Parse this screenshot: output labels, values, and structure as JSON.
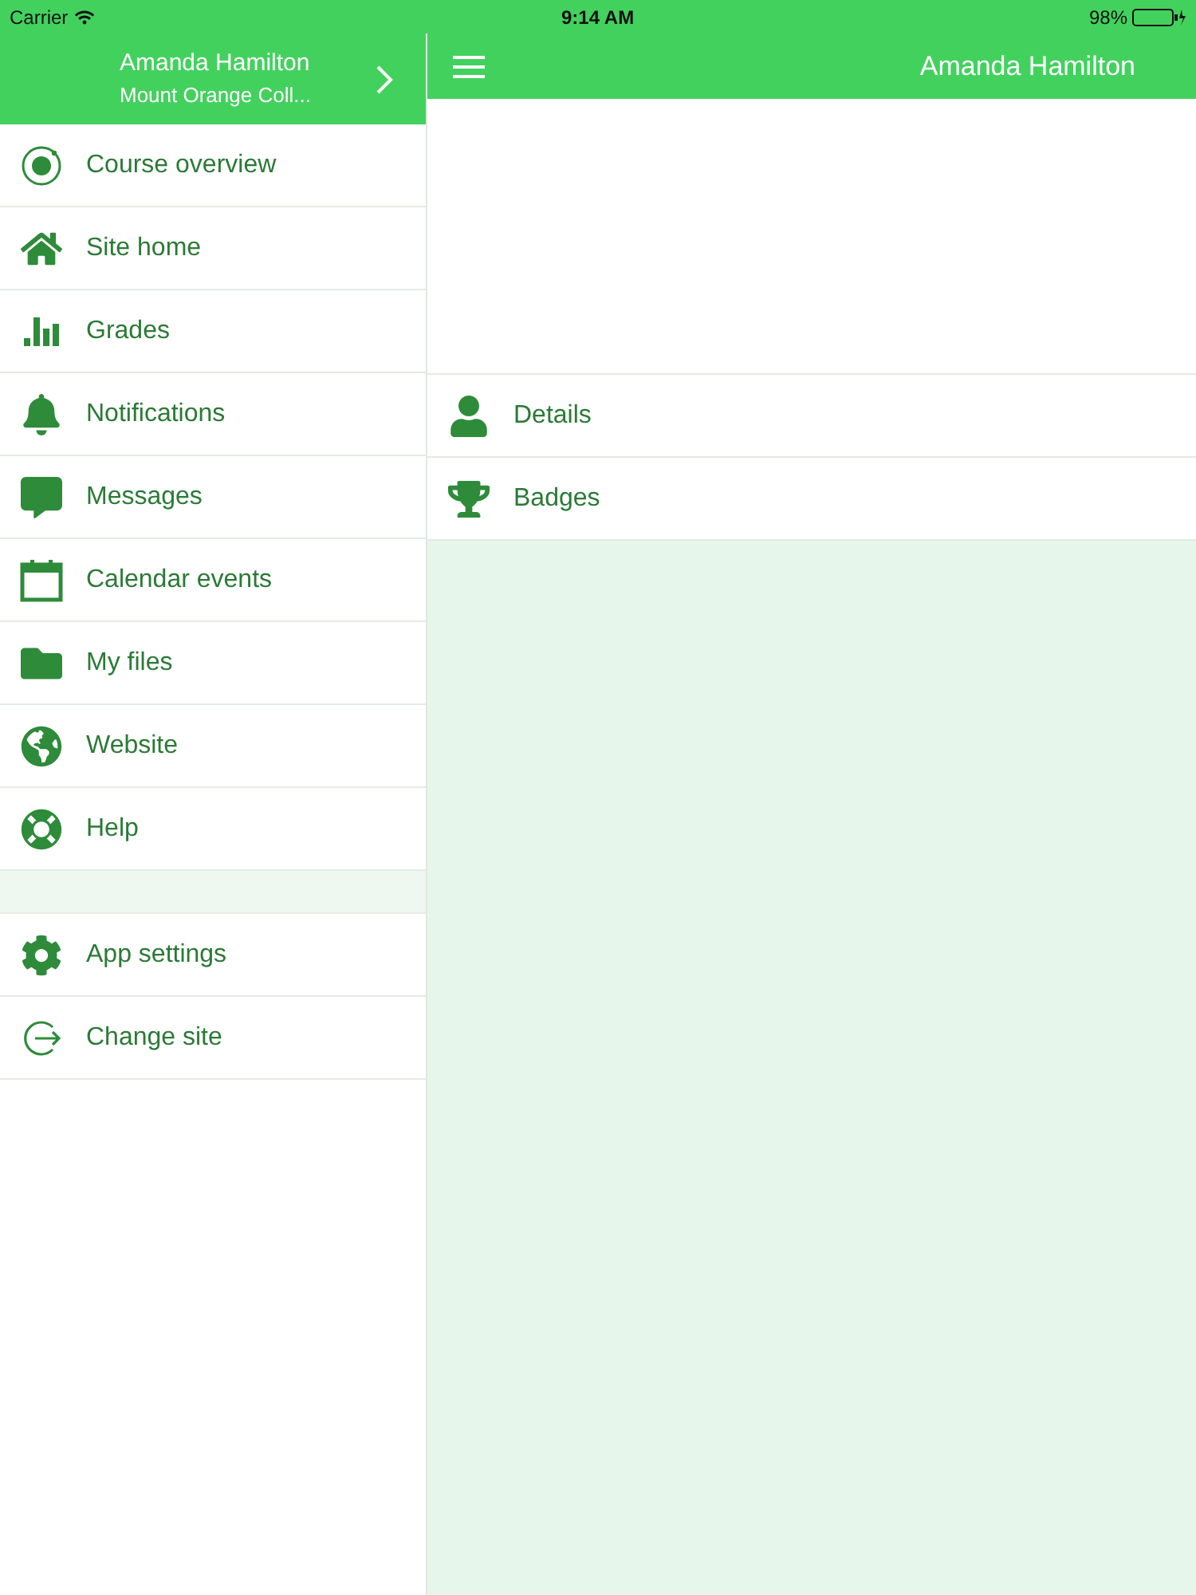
{
  "status_bar": {
    "carrier": "Carrier",
    "time": "9:14 AM",
    "battery": "98%"
  },
  "sidebar": {
    "user_name": "Amanda Hamilton",
    "site_name": "Mount Orange Coll...",
    "items": [
      {
        "label": "Course overview",
        "kind": "course"
      },
      {
        "label": "Site home",
        "kind": "home"
      },
      {
        "label": "Grades",
        "kind": "grades"
      },
      {
        "label": "Notifications",
        "kind": "bell"
      },
      {
        "label": "Messages",
        "kind": "message"
      },
      {
        "label": "Calendar events",
        "kind": "calendar"
      },
      {
        "label": "My files",
        "kind": "folder"
      },
      {
        "label": "Website",
        "kind": "globe"
      },
      {
        "label": "Help",
        "kind": "help"
      }
    ],
    "bottom_items": [
      {
        "label": "App settings",
        "kind": "gear"
      },
      {
        "label": "Change site",
        "kind": "exit"
      }
    ]
  },
  "main": {
    "title": "Amanda Hamilton",
    "items": [
      {
        "label": "Details",
        "kind": "user"
      },
      {
        "label": "Badges",
        "kind": "trophy"
      }
    ]
  }
}
